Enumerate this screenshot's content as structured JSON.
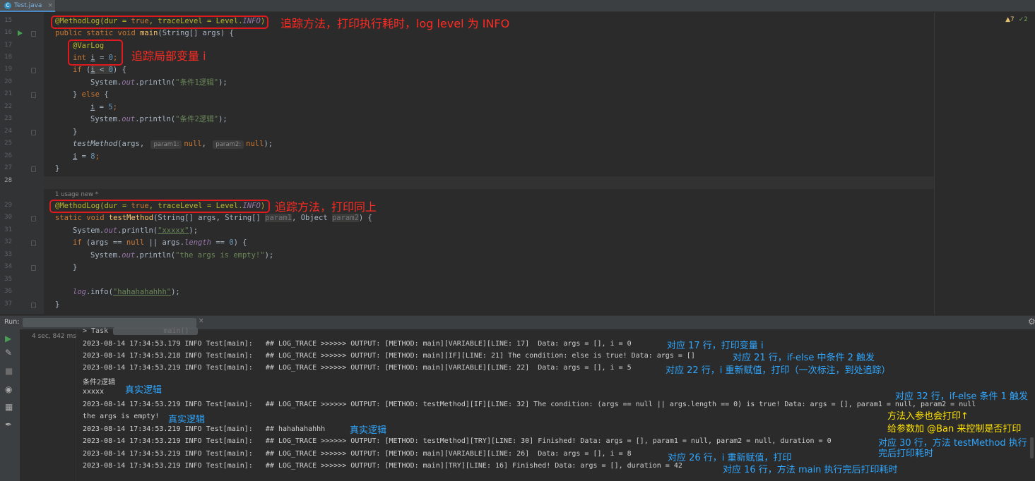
{
  "tab": {
    "filename": "Test.java",
    "close": "×"
  },
  "warnings": {
    "warn_count": "▲7",
    "check_count": "✓2"
  },
  "editor": {
    "line_numbers": [
      "15",
      "16",
      "17",
      "18",
      "19",
      "20",
      "21",
      "22",
      "23",
      "24",
      "25",
      "26",
      "27",
      "28",
      "29",
      "30",
      "31",
      "32",
      "33",
      "34",
      "35",
      "36",
      "37"
    ],
    "usage_hint": "1 usage   new *",
    "hints": {
      "param1": "param1:",
      "param2": "param2:"
    }
  },
  "code": {
    "l15": {
      "a": "@MethodLog(dur = ",
      "b": "true",
      "c": ", traceLevel = Level.",
      "d": "INFO",
      "e": ")"
    },
    "l16": {
      "a": "public static void ",
      "b": "main",
      "c": "(String[] args) {"
    },
    "l17": "@VarLog",
    "l18": {
      "a": "int ",
      "b": "i",
      "c": " = ",
      "d": "0",
      "e": ";"
    },
    "l19": {
      "a": "if ",
      "b": "(",
      "c": "i",
      "d": " < ",
      "e": "0",
      "f": ") {"
    },
    "l20": {
      "a": "System.",
      "b": "out",
      "c": ".println(",
      "d": "\"条件1逻辑\"",
      "e": ");"
    },
    "l21": {
      "a": "} ",
      "b": "else",
      "c": " {"
    },
    "l22": {
      "a": "i",
      "b": " = ",
      "c": "5",
      "d": ";"
    },
    "l23": {
      "a": "System.",
      "b": "out",
      "c": ".println(",
      "d": "\"条件2逻辑\"",
      "e": ");"
    },
    "l24": "}",
    "l25": {
      "a": "testMethod",
      "b": "(args, ",
      "c": "null",
      "d": ", ",
      "e": "null",
      "f": ");"
    },
    "l26": {
      "a": "i",
      "b": " = ",
      "c": "8",
      "d": ";"
    },
    "l27": "}",
    "l29": {
      "a": "@MethodLog(dur = ",
      "b": "true",
      "c": ", traceLevel = Level.",
      "d": "INFO",
      "e": ")"
    },
    "l30": {
      "a": "static void ",
      "b": "testMethod",
      "c": "(String[] args, String[] ",
      "d": "param1",
      "e": ", Object ",
      "f": "param2",
      "g": ") {"
    },
    "l31": {
      "a": "System.",
      "b": "out",
      "c": ".println(",
      "d": "\"xxxxx\"",
      "e": ");"
    },
    "l32": {
      "a": "if ",
      "b": "(args == ",
      "c": "null",
      "d": " || args.",
      "e": "length",
      "f": " == ",
      "g": "0",
      "h": ") {"
    },
    "l33": {
      "a": "System.",
      "b": "out",
      "c": ".println(",
      "d": "\"the args is empty!\"",
      "e": ");"
    },
    "l34": "}",
    "l36": {
      "a": "log",
      "b": ".info(",
      "c": "\"hahahahahhh\"",
      "d": ");"
    },
    "l37": "}"
  },
  "annotations_red": {
    "a1": "追踪方法，打印执行耗时，log level 为 INFO",
    "a2": "追踪局部变量 i",
    "a3": "追踪方法，打印同上"
  },
  "run": {
    "label": "Run:",
    "tab_close": "×",
    "time": "4 sec, 842 ms",
    "gear": "⚙",
    "top_line": "> Task             main()"
  },
  "console": [
    "2023-08-14 17:34:53.179 INFO Test[main]:   ## LOG_TRACE >>>>>> OUTPUT: [METHOD: main][VARIABLE][LINE: 17]  Data: args = [], i = 0",
    "2023-08-14 17:34:53.218 INFO Test[main]:   ## LOG_TRACE >>>>>> OUTPUT: [METHOD: main][IF][LINE: 21] The condition: else is true! Data: args = []",
    "2023-08-14 17:34:53.219 INFO Test[main]:   ## LOG_TRACE >>>>>> OUTPUT: [METHOD: main][VARIABLE][LINE: 22]  Data: args = [], i = 5",
    "条件2逻辑",
    "xxxxx",
    "2023-08-14 17:34:53.219 INFO Test[main]:   ## LOG_TRACE >>>>>> OUTPUT: [METHOD: testMethod][IF][LINE: 32] The condition: (args == null || args.length == 0) is true! Data: args = [], param1 = null, param2 = null",
    "the args is empty!",
    "2023-08-14 17:34:53.219 INFO Test[main]:   ## hahahahahhh",
    "2023-08-14 17:34:53.219 INFO Test[main]:   ## LOG_TRACE >>>>>> OUTPUT: [METHOD: testMethod][TRY][LINE: 30] Finished! Data: args = [], param1 = null, param2 = null, duration = 0",
    "2023-08-14 17:34:53.219 INFO Test[main]:   ## LOG_TRACE >>>>>> OUTPUT: [METHOD: main][VARIABLE][LINE: 26]  Data: args = [], i = 8",
    "2023-08-14 17:34:53.219 INFO Test[main]:   ## LOG_TRACE >>>>>> OUTPUT: [METHOD: main][TRY][LINE: 16] Finished! Data: args = [], duration = 42"
  ],
  "annotations_blue": {
    "b1": "对应 17 行，打印变量 i",
    "b2": "对应 21 行，if-else 中条件 2 触发",
    "b3": "对应 22 行，i 重新赋值，打印（一次标注，到处追踪）",
    "b4": "真实逻辑",
    "b5": "对应 32 行，if-else 条件 1 触发",
    "b6": "真实逻辑",
    "b7": "真实逻辑",
    "b8a": "对应 30 行，方法 testMethod 执行",
    "b8b": "完后打印耗时",
    "b9": "对应 26 行，i 重新赋值，打印",
    "b10": "对应 16 行，方法 main 执行完后打印耗时"
  },
  "annotations_yellow": {
    "y1": "方法入参也会打印↑",
    "y2": "给参数加 @Ban 来控制是否打印"
  },
  "colors": {
    "accent": "#4a88c7",
    "annotation_red": "#ff2a22",
    "annotation_blue": "#2fa7ff",
    "annotation_yellow": "#ffe100"
  }
}
